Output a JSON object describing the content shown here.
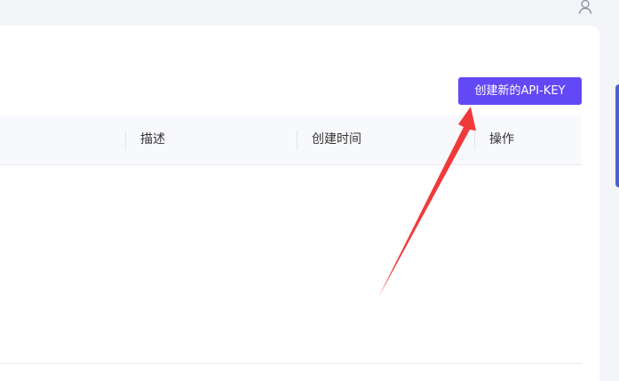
{
  "header": {
    "user_icon": "user-icon"
  },
  "toolbar": {
    "create_label": "创建新的API-KEY"
  },
  "table": {
    "columns": [
      "描述",
      "创建时间",
      "操作"
    ]
  },
  "colors": {
    "accent": "#6348f5",
    "annotation_arrow": "#f03a3a"
  }
}
